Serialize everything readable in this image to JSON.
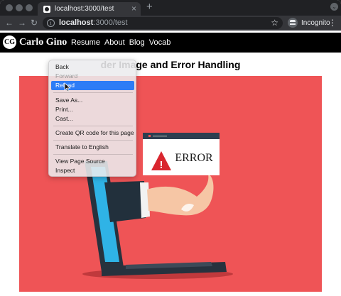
{
  "browser": {
    "tab_title": "localhost:3000/test",
    "tab_close": "×",
    "new_tab": "+",
    "nav_back": "←",
    "nav_forward": "→",
    "nav_reload": "↻",
    "info": "i",
    "url_host": "localhost",
    "url_path": ":3000/test",
    "bookmark": "☆",
    "profile_label": "Incognito",
    "menu": "⋮"
  },
  "site": {
    "logo_text": "CG",
    "brand": "Carlo Gino",
    "nav": [
      "Resume",
      "About",
      "Blog",
      "Vocab"
    ],
    "page_title": "der Image and Error Handling"
  },
  "hero_image": {
    "error_text": "ERROR",
    "warning_glyph": "!",
    "colors": {
      "background": "#ef5456",
      "laptop": "#27323e",
      "screen": "#2fb3e6",
      "popup_bar": "#2c3e50",
      "warning": "#d9262f"
    }
  },
  "context_menu": {
    "items": [
      {
        "label": "Back",
        "state": "normal"
      },
      {
        "label": "Forward",
        "state": "disabled"
      },
      {
        "label": "Reload",
        "state": "selected"
      },
      {
        "label": "Save As...",
        "state": "normal"
      },
      {
        "label": "Print...",
        "state": "normal"
      },
      {
        "label": "Cast...",
        "state": "normal"
      },
      {
        "label": "Create QR code for this page",
        "state": "normal"
      },
      {
        "label": "Translate to English",
        "state": "normal"
      },
      {
        "label": "View Page Source",
        "state": "normal"
      },
      {
        "label": "Inspect",
        "state": "normal"
      }
    ]
  }
}
